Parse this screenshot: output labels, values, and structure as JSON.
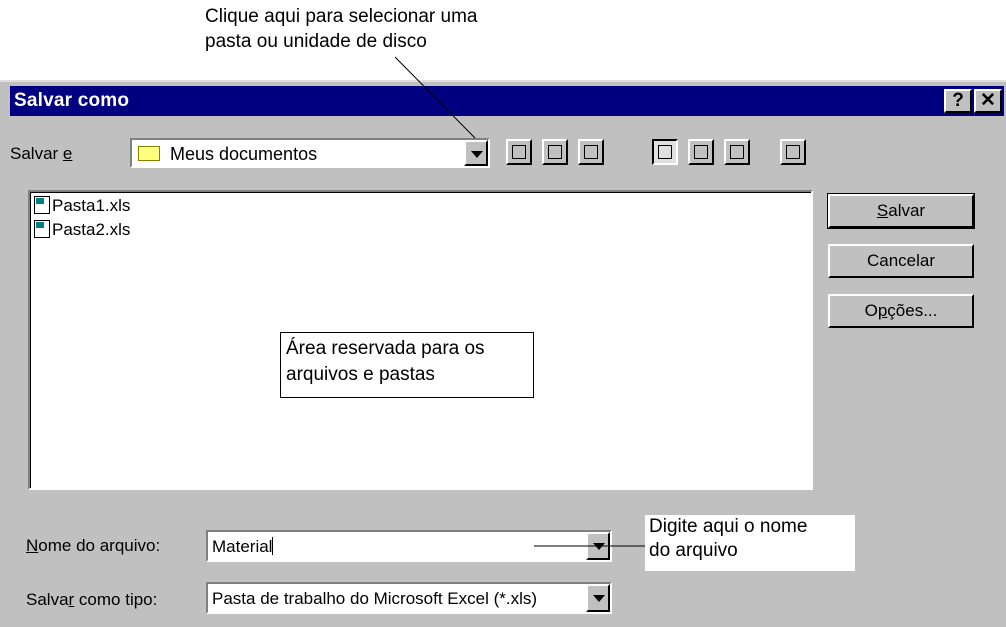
{
  "annotations": {
    "folder_tip_line1": "Clique aqui para selecionar uma",
    "folder_tip_line2": "pasta ou unidade de disco",
    "files_area_line1": "Área reservada para os",
    "files_area_line2": "arquivos e pastas",
    "filename_tip_line1": "Digite aqui o nome",
    "filename_tip_line2": "do arquivo"
  },
  "dialog": {
    "title": "Salvar como",
    "help": "?",
    "close": "✕"
  },
  "save_in": {
    "label_prefix": "Salvar ",
    "label_accel": "e",
    "value": "Meus documentos"
  },
  "toolbar_icons": [
    "up-one-level-icon",
    "favorites-icon",
    "new-folder-icon",
    "list-view-icon",
    "details-view-icon",
    "properties-view-icon",
    "commands-icon"
  ],
  "files": [
    {
      "name": "Pasta1.xls",
      "icon": "excel-file-icon"
    },
    {
      "name": "Pasta2.xls",
      "icon": "excel-file-icon"
    }
  ],
  "buttons": {
    "save_accel": "S",
    "save_rest": "alvar",
    "cancel": "Cancelar",
    "options_prefix": "O",
    "options_accel": "p",
    "options_rest": "ções..."
  },
  "filename": {
    "label_accel": "N",
    "label_rest": "ome do arquivo:",
    "value": "Material"
  },
  "filetype": {
    "label_prefix": "Salva",
    "label_accel": "r",
    "label_rest": " como tipo:",
    "value": "Pasta de trabalho do Microsoft Excel (*.xls)"
  },
  "colors": {
    "titlebar": "#000080",
    "face": "#c0c0c0"
  }
}
